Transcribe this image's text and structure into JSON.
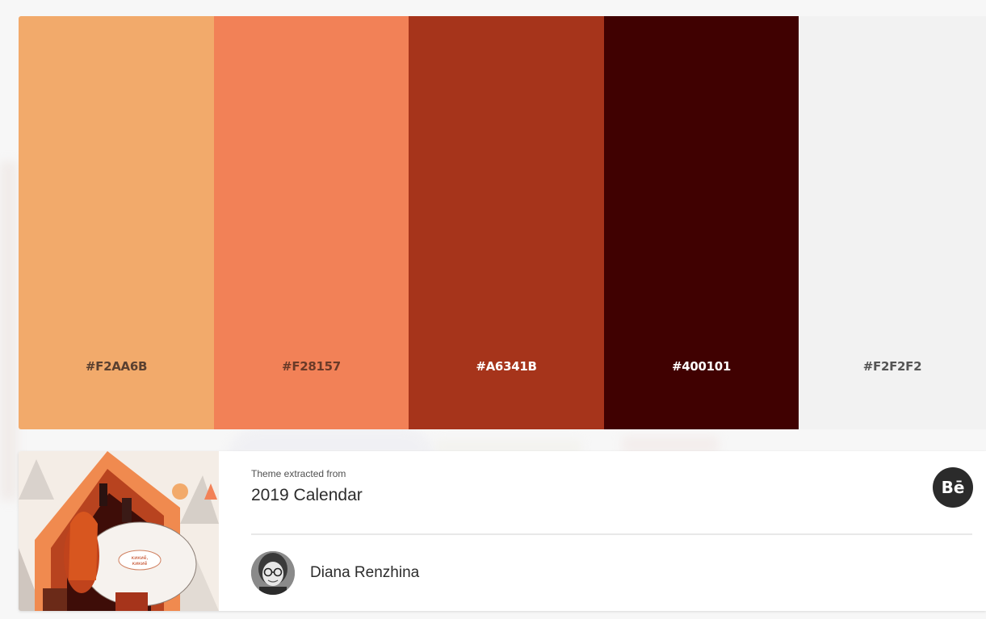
{
  "palette": {
    "swatches": [
      {
        "hex": "#F2AA6B",
        "color": "#F2AA6B",
        "label_color": "#5a4030"
      },
      {
        "hex": "#F28157",
        "color": "#F28157",
        "label_color": "#6a3a28"
      },
      {
        "hex": "#A6341B",
        "color": "#A6341B",
        "label_color": "#ffffff"
      },
      {
        "hex": "#400101",
        "color": "#400101",
        "label_color": "#ffffff"
      },
      {
        "hex": "#F2F2F2",
        "color": "#F2F2F2",
        "label_color": "#555555"
      }
    ]
  },
  "source": {
    "extracted_label": "Theme extracted from",
    "title": "2019 Calendar",
    "behance_glyph": "Bē",
    "thumbnail_icon": "illustration-thumbnail",
    "speech_bubble": "кикиё, кикиё"
  },
  "author": {
    "name": "Diana Renzhina"
  }
}
